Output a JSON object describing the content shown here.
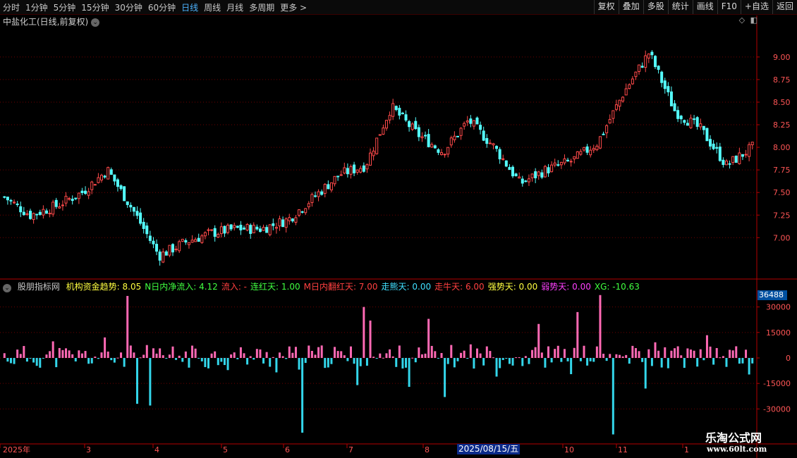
{
  "toolbar": {
    "periods": [
      "分时",
      "1分钟",
      "5分钟",
      "15分钟",
      "30分钟",
      "60分钟",
      "日线",
      "周线",
      "月线",
      "多周期",
      "更多 >"
    ],
    "active_period": "日线",
    "actions": [
      "复权",
      "叠加",
      "多股",
      "统计",
      "画线",
      "F10",
      "+自选",
      "返回"
    ]
  },
  "stock_title": "中盐化工(日线,前复权)",
  "indicator": {
    "name": "股朋指标网",
    "items": [
      {
        "label": "机构资金趋势: 8.05",
        "color": "#ffff40"
      },
      {
        "label": "N日内净流入: 4.12",
        "color": "#40ff40"
      },
      {
        "label": "流入: -",
        "color": "#ff4040"
      },
      {
        "label": "连红天: 1.00",
        "color": "#40ff40"
      },
      {
        "label": "M日内翻红天: 7.00",
        "color": "#ff4040"
      },
      {
        "label": "走熊天: 0.00",
        "color": "#40e0ff"
      },
      {
        "label": "走牛天: 6.00",
        "color": "#ff4040"
      },
      {
        "label": "强势天: 0.00",
        "color": "#ffff40"
      },
      {
        "label": "弱势天: 0.00",
        "color": "#ff40ff"
      },
      {
        "label": "XG: -10.63",
        "color": "#40ff40"
      }
    ],
    "vmax_label": "36488"
  },
  "date_label": "2025/08/15/五",
  "watermark": {
    "title": "乐淘公式网",
    "url": "www.60lt.com"
  },
  "colors": {
    "up": "#ff4a4a",
    "down": "#54ffff",
    "pos_bar": "#ff69b4",
    "neg_bar": "#33d6ea",
    "grid": "#6e0000",
    "axis": "#b40000"
  },
  "chart_data": [
    {
      "type": "candlestick",
      "title": "中盐化工(日线,前复权)",
      "y_ticks": [
        "9.00",
        "8.75",
        "8.50",
        "8.25",
        "8.00",
        "7.75",
        "7.50",
        "7.25",
        "7.00"
      ],
      "ylim": [
        6.55,
        9.35
      ],
      "x_ticks": [
        "2025年",
        "3",
        "4",
        "5",
        "6",
        "7",
        "8",
        "10",
        "11",
        "1"
      ],
      "close_trend": [
        {
          "m": "2025-01-start",
          "v": 7.45
        },
        {
          "m": "2025-02-mid",
          "v": 7.25
        },
        {
          "m": "2025-03-start",
          "v": 7.35
        },
        {
          "m": "2025-03-mid",
          "v": 7.5
        },
        {
          "m": "2025-03-end",
          "v": 7.75
        },
        {
          "m": "2025-04-02",
          "v": 7.3
        },
        {
          "m": "2025-04-07",
          "v": 6.8
        },
        {
          "m": "2025-04-mid",
          "v": 6.95
        },
        {
          "m": "2025-05-start",
          "v": 7.05
        },
        {
          "m": "2025-05-mid",
          "v": 7.1
        },
        {
          "m": "2025-06-start",
          "v": 7.1
        },
        {
          "m": "2025-06-mid",
          "v": 7.2
        },
        {
          "m": "2025-06-end",
          "v": 7.45
        },
        {
          "m": "2025-07-start",
          "v": 7.7
        },
        {
          "m": "2025-07-mid",
          "v": 7.8
        },
        {
          "m": "2025-07-end",
          "v": 8.45
        },
        {
          "m": "2025-08-start",
          "v": 8.15
        },
        {
          "m": "2025-08-mid",
          "v": 7.95
        },
        {
          "m": "2025-09-start",
          "v": 8.3
        },
        {
          "m": "2025-09-mid",
          "v": 8.0
        },
        {
          "m": "2025-09-end",
          "v": 7.6
        },
        {
          "m": "2025-10-start",
          "v": 7.75
        },
        {
          "m": "2025-10-mid",
          "v": 7.85
        },
        {
          "m": "2025-10-end",
          "v": 8.05
        },
        {
          "m": "2025-11-start",
          "v": 8.6
        },
        {
          "m": "2025-11-mid",
          "v": 9.05
        },
        {
          "m": "2025-11-end",
          "v": 8.4
        },
        {
          "m": "2025-12-start",
          "v": 8.2
        },
        {
          "m": "2025-12-mid",
          "v": 7.8
        },
        {
          "m": "2026-01-start",
          "v": 8.0
        }
      ]
    },
    {
      "type": "bar",
      "title": "股朋指标网",
      "y_ticks": [
        "36488",
        "30000",
        "15000",
        "0",
        "-15000",
        "-30000"
      ],
      "ylim": [
        -40000,
        40000
      ],
      "tall_spikes": [
        {
          "near": "3月末",
          "v": 36488
        },
        {
          "near": "4月初",
          "v": -27000
        },
        {
          "near": "6月末",
          "v": -44000
        },
        {
          "near": "7月末",
          "v": 30000
        },
        {
          "near": "8月末",
          "v": -24000
        },
        {
          "near": "11月中",
          "v": 38000
        },
        {
          "near": "11月末",
          "v": -45000
        }
      ]
    }
  ]
}
